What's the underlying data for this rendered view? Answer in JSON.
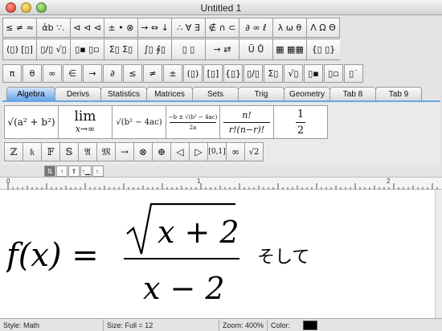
{
  "window": {
    "title": "Untitled 1"
  },
  "palette": {
    "row1": [
      "≤ ≠ ≈",
      "ἀb ∵.",
      "⊲ ⊲ ⊲",
      "± • ⊗",
      "→ ⇔ ↓",
      "∴ ∀ ∃",
      "∉ ∩ ⊂",
      "∂ ∞ ℓ",
      "λ ω θ",
      "Λ Ω Θ"
    ],
    "row2": [
      "(▯) [▯]",
      "▯/▯ √▯",
      "▯▪ ▯▫",
      "Σ▯ Σ▯",
      "∫▯ ∮▯",
      "▯ ▯",
      "→ ⇄",
      "Ū Ů",
      "▦ ▦▦",
      "{▯ ▯}"
    ],
    "row3": [
      "π",
      "θ",
      "∞",
      "∈",
      "→",
      "∂",
      "≤",
      "≠",
      "±",
      "(▯)",
      "[▯]",
      "{▯}",
      "▯/▯",
      "Σ▯",
      "√▯",
      "▯▪",
      "▯▫",
      "▯˙"
    ]
  },
  "tabs": [
    "Algebra",
    "Derivs",
    "Statistics",
    "Matrices",
    "Sets",
    "Trig",
    "Geometry",
    "Tab 8",
    "Tab 9"
  ],
  "active_tab": "Algebra",
  "templates": {
    "sqrt_sum": "√(a² + b²)",
    "lim_word": "lim",
    "lim_sub": "x→∞",
    "sqrt_disc": "√(b² − 4ac)",
    "quadratic_num": "−b ± √(b² − 4ac)",
    "quadratic_den": "2a",
    "binom_num": "n!",
    "binom_den": "r!(n−r)!",
    "half_num": "1",
    "half_den": "2"
  },
  "symbols": [
    "ℤ",
    "𝔨",
    "𝔽",
    "𝕊",
    "𝔄",
    "𝔐",
    "→",
    "⊗",
    "⊕",
    "◁",
    "▷",
    "[0,1]",
    "∞",
    "√2"
  ],
  "style_buttons": [
    "⇅",
    "↑",
    "⇑",
    "↑▁",
    "↑."
  ],
  "ruler": {
    "marks": [
      "0",
      "1",
      "2"
    ]
  },
  "equation": {
    "lhs": "f(x) =",
    "numerator": "x + 2",
    "denominator": "x − 2",
    "trailing_text": "そして"
  },
  "status": {
    "style": "Style: Math",
    "size": "Size: Full = 12",
    "zoom": "Zoom: 400%",
    "color_label": "Color:",
    "color_value": "#000000"
  }
}
